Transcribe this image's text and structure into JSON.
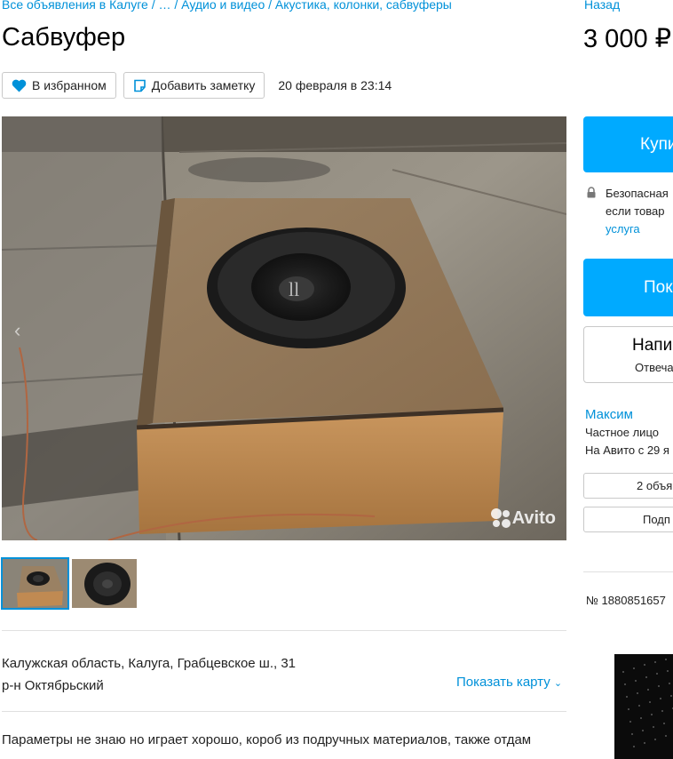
{
  "breadcrumb": "Все объявления в Калуге / … / Аудио и видео / Акустика, колонки, сабвуферы",
  "back_link": "Назад",
  "title": "Сабвуфер",
  "price": "3 000 ₽",
  "actions": {
    "favorite_label": "В избранном",
    "note_label": "Добавить заметку",
    "date": "20 февраля в 23:14"
  },
  "gallery": {
    "prev_arrow": "‹",
    "watermark": "Avito"
  },
  "location": {
    "address": "Калужская область, Калуга, Грабцевское ш., 31",
    "district": "р-н Октябрьский",
    "show_map": "Показать карту"
  },
  "description": "Параметры не знаю но играет хорошо, короб из подручных материалов, также отдам",
  "sidebar": {
    "buy_label": "Купи",
    "secure_line1": "Безопасная",
    "secure_line2": "если товар",
    "secure_link": "услуга",
    "show_phone_label": "Пок",
    "write_label": "Напи",
    "write_sub": "Отвеча",
    "seller_name": "Максим",
    "seller_type": "Частное лицо",
    "seller_since": "На Авито с 29 я",
    "listings_button": "2 объя",
    "subscribe_button": "Подп",
    "ad_number": "№ 1880851657"
  },
  "colors": {
    "accent": "#00aaff",
    "link": "#0091d9",
    "favorite_heart": "#0091d9"
  }
}
